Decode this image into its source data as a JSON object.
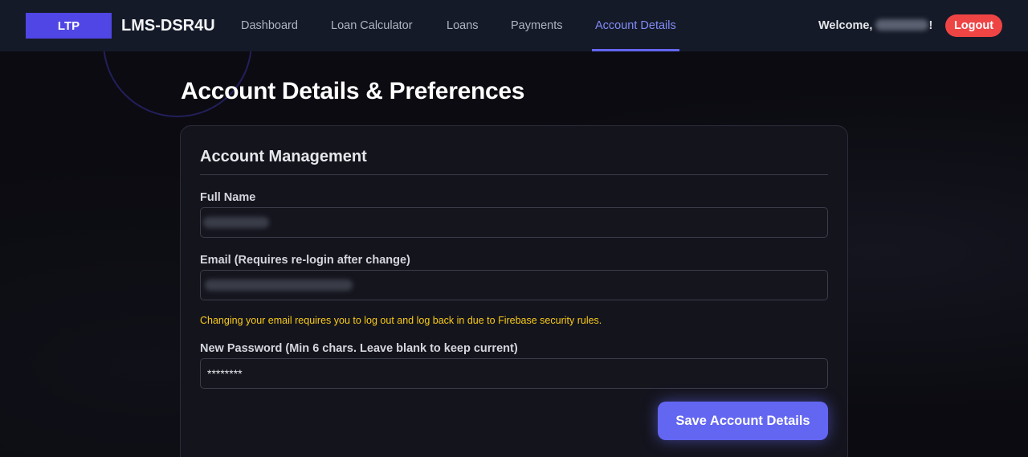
{
  "header": {
    "logo_text": "LTP",
    "brand": "LMS-DSR4U",
    "nav": [
      {
        "label": "Dashboard"
      },
      {
        "label": "Loan Calculator"
      },
      {
        "label": "Loans"
      },
      {
        "label": "Payments"
      },
      {
        "label": "Account Details",
        "active": true
      }
    ],
    "welcome_text": "Welcome,",
    "welcome_suffix": "!",
    "logout_label": "Logout"
  },
  "page": {
    "title": "Account Details & Preferences"
  },
  "account_card": {
    "title": "Account Management",
    "full_name": {
      "label": "Full Name",
      "value": ""
    },
    "email": {
      "label": "Email (Requires re-login after change)",
      "value": "",
      "hint": "Changing your email requires you to log out and log back in due to Firebase security rules."
    },
    "password": {
      "label": "New Password (Min 6 chars. Leave blank to keep current)",
      "value": "********"
    },
    "save_label": "Save Account Details"
  },
  "colors": {
    "accent": "#6366f1",
    "logo_bg": "#4f46e5",
    "logout": "#ef4444",
    "warning_text": "#facc15",
    "navbar_bg": "#151a28"
  }
}
